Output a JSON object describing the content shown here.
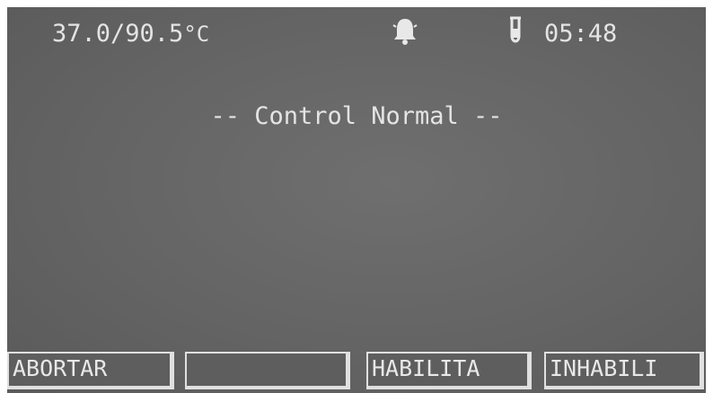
{
  "status": {
    "temperature": "37.0/90.5",
    "temperature_unit": "°C",
    "clock": "05:48",
    "icons": [
      "bell-icon",
      "test-tube-icon"
    ]
  },
  "main": {
    "message": "-- Control Normal --"
  },
  "softkeys": [
    {
      "label": "ABORTAR"
    },
    {
      "label": ""
    },
    {
      "label": "HABILITA"
    },
    {
      "label": "INHABILI"
    }
  ],
  "colors": {
    "screen": "#646464",
    "text": "#e4e4e4"
  }
}
